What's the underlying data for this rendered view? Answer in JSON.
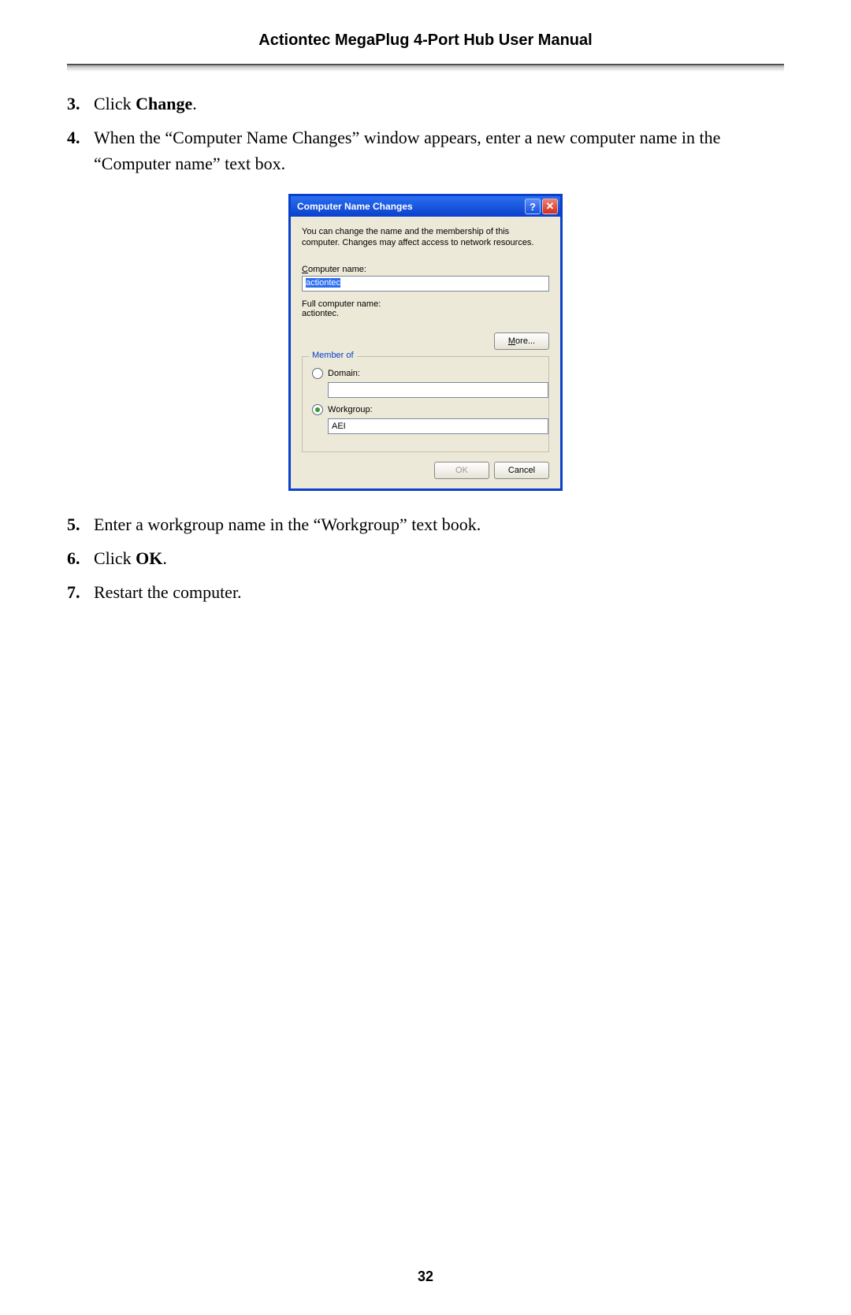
{
  "header": {
    "manual_title": "Actiontec MegaPlug 4-Port Hub User Manual"
  },
  "steps": [
    {
      "num": "3.",
      "prefix": "Click ",
      "bold": "Change",
      "suffix": "."
    },
    {
      "num": "4.",
      "prefix": "When the “Computer Name Changes” window appears, enter a new computer name in the “Computer name” text box.",
      "bold": "",
      "suffix": ""
    },
    {
      "num": "5.",
      "prefix": "Enter a workgroup name in the “Workgroup” text book.",
      "bold": "",
      "suffix": ""
    },
    {
      "num": "6.",
      "prefix": "Click ",
      "bold": "OK",
      "suffix": "."
    },
    {
      "num": "7.",
      "prefix": "Restart the computer.",
      "bold": "",
      "suffix": ""
    }
  ],
  "dialog": {
    "title": "Computer Name Changes",
    "description": "You can change the name and the membership of this computer. Changes may affect access to network resources.",
    "computer_name_label_pre": "C",
    "computer_name_label_post": "omputer name:",
    "computer_name_value": "actiontec",
    "full_computer_name_label": "Full computer name:",
    "full_computer_name_value": "actiontec.",
    "more_button_pre": "M",
    "more_button_post": "ore...",
    "member_of_legend": "Member of",
    "domain_label_pre": "D",
    "domain_label_post": "omain:",
    "domain_value": "",
    "workgroup_label_pre": "W",
    "workgroup_label_post": "orkgroup:",
    "workgroup_value": "AEI",
    "ok_label": "OK",
    "cancel_label": "Cancel",
    "help_icon_glyph": "?",
    "close_icon_glyph": "✕",
    "domain_selected": false,
    "workgroup_selected": true
  },
  "footer": {
    "page_number": "32"
  }
}
